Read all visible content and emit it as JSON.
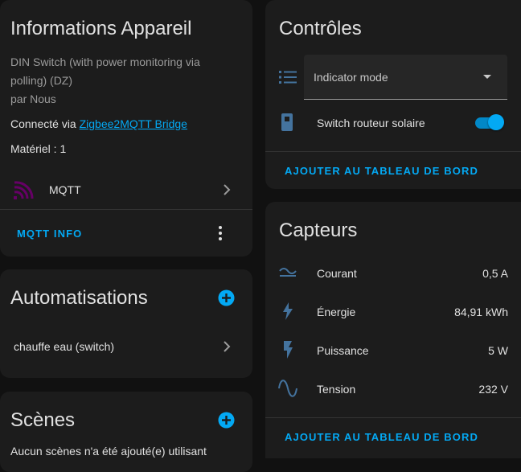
{
  "device_info": {
    "title": "Informations Appareil",
    "model": "DIN Switch (with power monitoring via polling) (DZ)",
    "manufacturer": "par Nous",
    "connected_prefix": "Connecté via ",
    "connected_link": "Zigbee2MQTT Bridge",
    "hardware": "Matériel : 1",
    "integration": "MQTT",
    "action": "MQTT INFO"
  },
  "automations": {
    "title": "Automatisations",
    "items": [
      "chauffe eau (switch)"
    ]
  },
  "scenes": {
    "title": "Scènes",
    "empty_text": "Aucun scènes n'a été ajouté(e) utilisant"
  },
  "controls": {
    "title": "Contrôles",
    "select_label": "Indicator mode",
    "switch_label": "Switch routeur solaire",
    "switch_on": true,
    "action": "AJOUTER AU TABLEAU DE BORD"
  },
  "sensors": {
    "title": "Capteurs",
    "items": [
      {
        "label": "Courant",
        "value": "0,5 A",
        "icon": "current-ac-icon"
      },
      {
        "label": "Énergie",
        "value": "84,91 kWh",
        "icon": "lightning-bolt-icon"
      },
      {
        "label": "Puissance",
        "value": "5 W",
        "icon": "flash-icon"
      },
      {
        "label": "Tension",
        "value": "232 V",
        "icon": "sine-wave-icon"
      }
    ],
    "action": "AJOUTER AU TABLEAU DE BORD"
  },
  "colors": {
    "accent": "#03a9f4",
    "icon": "#44739e",
    "mqtt": "#660066"
  }
}
